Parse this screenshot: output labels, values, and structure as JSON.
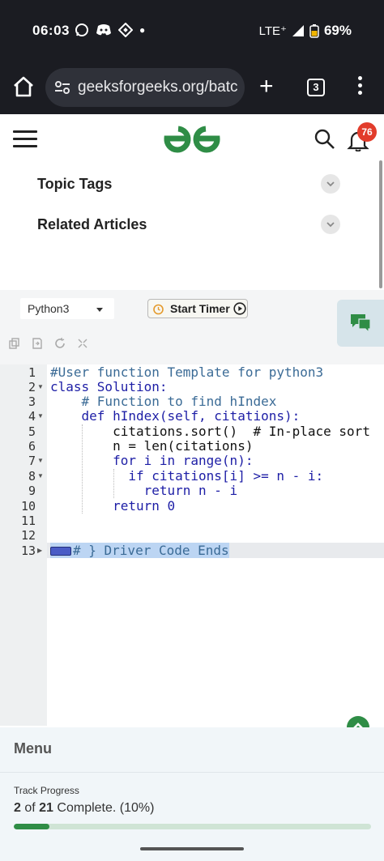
{
  "status_bar": {
    "time": "06:03",
    "network": "LTE⁺",
    "battery": "69%"
  },
  "browser": {
    "url": "geeksforgeeks.org/batc",
    "tab_count": "3"
  },
  "header": {
    "notification_count": "76"
  },
  "accordion": [
    {
      "label": "Topic Tags"
    },
    {
      "label": "Related Articles"
    }
  ],
  "toolbar": {
    "language": "Python3",
    "start_timer_label": "Start Timer"
  },
  "editor": {
    "line_numbers": [
      "1",
      "2",
      "3",
      "4",
      "5",
      "6",
      "7",
      "8",
      "9",
      "10",
      "11",
      "12",
      "13"
    ],
    "lines": [
      "#User function Template for python3",
      "class Solution:",
      "    # Function to find hIndex",
      "    def hIndex(self, citations):",
      "        citations.sort()  # In-place sort",
      "        n = len(citations)",
      "        for i in range(n):",
      "          if citations[i] >= n - i:",
      "            return n - i",
      "        return 0",
      "",
      "",
      "# } Driver Code Ends"
    ]
  },
  "bottom": {
    "menu_title": "Menu",
    "track_label": "Track Progress",
    "completed": "2",
    "total": "21",
    "of_text": "of",
    "complete_text": "Complete.",
    "percent_text": "(10%)",
    "progress_fraction": 0.1
  },
  "colors": {
    "brand_green": "#2f8d46",
    "badge_red": "#e23c2b"
  }
}
